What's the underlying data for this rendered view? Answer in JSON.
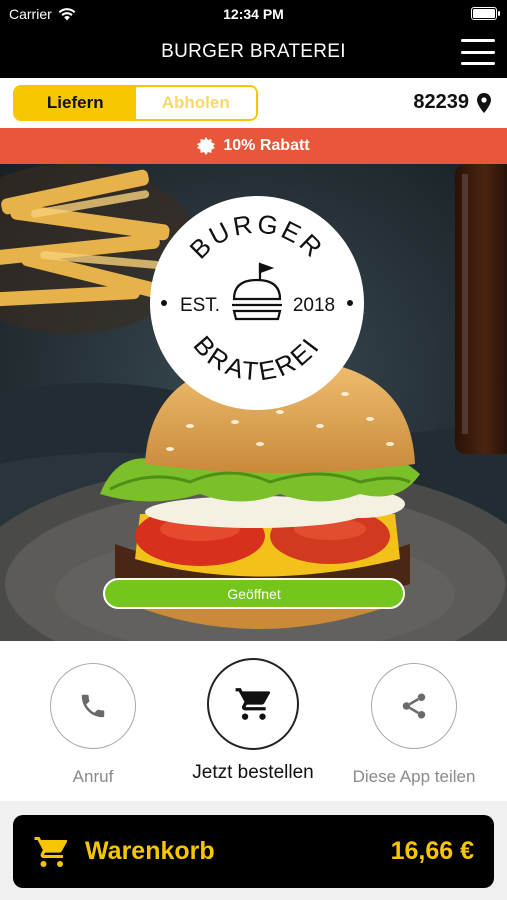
{
  "status_bar": {
    "carrier": "Carrier",
    "time": "12:34 PM",
    "wifi_icon": "wifi-icon",
    "battery_icon": "battery-icon"
  },
  "header": {
    "title": "BURGER BRATEREI",
    "menu_icon": "hamburger-menu-icon"
  },
  "mode": {
    "options": [
      "Liefern",
      "Abholen"
    ],
    "selected": "Liefern",
    "postcode": "82239",
    "postcode_icon": "location-pin-icon"
  },
  "discount": {
    "text": "10% Rabatt",
    "icon": "badge-icon",
    "color": "#e8573a"
  },
  "hero": {
    "logo": {
      "top": "BURGER",
      "est": "EST.",
      "year": "2018",
      "bottom": "BRATEREI"
    },
    "status": "Geöffnet",
    "status_color": "#74c51c"
  },
  "actions": [
    {
      "label": "Anruf",
      "icon": "phone-icon"
    },
    {
      "label": "Jetzt bestellen",
      "icon": "cart-icon"
    },
    {
      "label": "Diese App teilen",
      "icon": "share-icon"
    }
  ],
  "cart": {
    "label": "Warenkorb",
    "total": "16,66 €",
    "icon": "cart-icon"
  },
  "colors": {
    "accent": "#f6c700",
    "bar": "#000000"
  }
}
